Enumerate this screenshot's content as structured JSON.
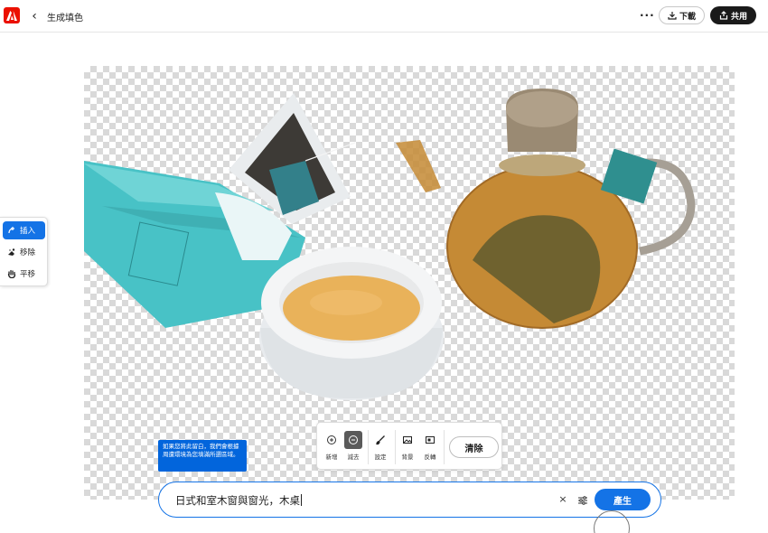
{
  "app": {
    "logo_icon": "adobe-logo-icon",
    "back_icon": "chevron-left-icon",
    "title": "生成填色",
    "accent_color": "#1473e6",
    "brand_color": "#eb1000"
  },
  "header": {
    "more_label": "···",
    "download_label": "下載",
    "share_label": "共用"
  },
  "tools": {
    "insert_label": "插入",
    "remove_label": "移除",
    "pan_label": "平移"
  },
  "toolbar": {
    "add_label": "新增",
    "subtract_label": "減去",
    "settings_label": "設定",
    "background_label": "背景",
    "invert_label": "反轉",
    "clear_label": "清除"
  },
  "tooltip": {
    "text": "如果您將此留白，我們會根據周遭環境為您填滿所選區域。"
  },
  "prompt": {
    "value": "日式和室木窗與窗光，木桌",
    "clear_label": "×",
    "generate_label": "產生"
  }
}
